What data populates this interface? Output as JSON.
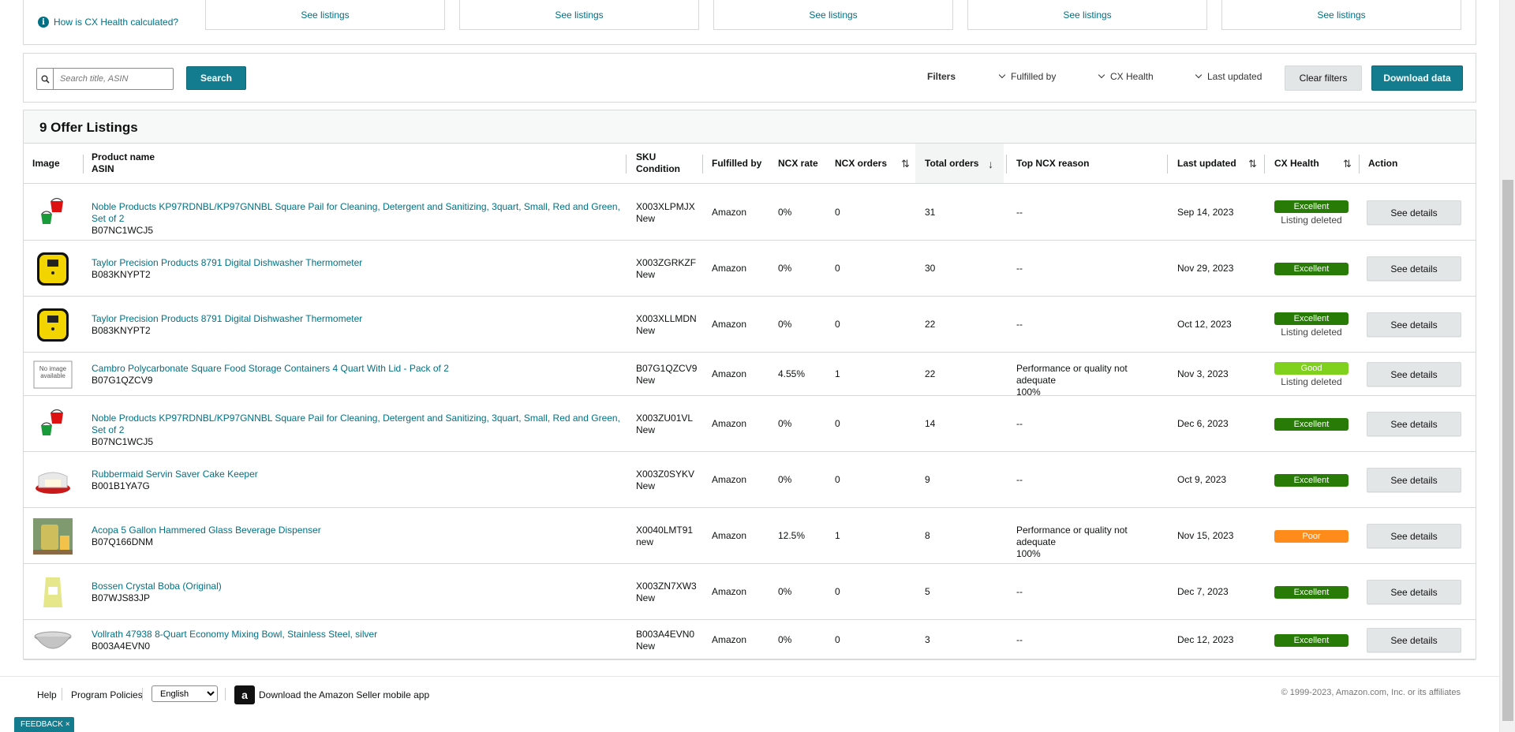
{
  "stats": {
    "how_calculated": "How is CX Health calculated?",
    "cells": [
      "See listings",
      "See listings",
      "See listings",
      "See listings",
      "See listings"
    ]
  },
  "toolbar": {
    "search_placeholder": "Search title, ASIN",
    "search_label": "Search",
    "filters_label": "Filters",
    "filter_fulfilled_by": "Fulfilled by",
    "filter_cx_health": "CX Health",
    "filter_last_updated": "Last updated",
    "clear_filters": "Clear filters",
    "download_data": "Download data"
  },
  "table": {
    "title": "9 Offer Listings",
    "headers": {
      "image": "Image",
      "product_name": "Product name",
      "asin": "ASIN",
      "sku": "SKU",
      "condition": "Condition",
      "fulfilled_by": "Fulfilled by",
      "ncx_rate": "NCX rate",
      "ncx_orders": "NCX orders",
      "total_orders": "Total orders",
      "top_ncx_reason": "Top NCX reason",
      "last_updated": "Last updated",
      "cx_health": "CX Health",
      "action": "Action"
    },
    "rows": [
      {
        "image": "red-green-pails",
        "name": "Noble Products KP97RDNBL/KP97GNNBL Square Pail for Cleaning, Detergent and Sanitizing, 3quart, Small, Red and Green, Set of 2",
        "asin": "B07NC1WCJ5",
        "sku": "X003XLPMJX",
        "condition": "New",
        "fulfilled_by": "Amazon",
        "ncx_rate": "0%",
        "ncx_orders": "0",
        "total_orders": "31",
        "reason_1": "--",
        "reason_2": "",
        "last_updated": "Sep 14, 2023",
        "health": "Excellent",
        "health_class": "excellent",
        "status": "Listing deleted",
        "action": "See details"
      },
      {
        "image": "yellow-thermometer",
        "name": "Taylor Precision Products 8791 Digital Dishwasher Thermometer",
        "asin": "B083KNYPT2",
        "sku": "X003ZGRKZF",
        "condition": "New",
        "fulfilled_by": "Amazon",
        "ncx_rate": "0%",
        "ncx_orders": "0",
        "total_orders": "30",
        "reason_1": "--",
        "reason_2": "",
        "last_updated": "Nov 29, 2023",
        "health": "Excellent",
        "health_class": "excellent",
        "status": "",
        "action": "See details"
      },
      {
        "image": "yellow-thermometer",
        "name": "Taylor Precision Products 8791 Digital Dishwasher Thermometer",
        "asin": "B083KNYPT2",
        "sku": "X003XLLMDN",
        "condition": "New",
        "fulfilled_by": "Amazon",
        "ncx_rate": "0%",
        "ncx_orders": "0",
        "total_orders": "22",
        "reason_1": "--",
        "reason_2": "",
        "last_updated": "Oct 12, 2023",
        "health": "Excellent",
        "health_class": "excellent",
        "status": "Listing deleted",
        "action": "See details"
      },
      {
        "image": "no-image",
        "no_image_text": "No image available",
        "name": "Cambro Polycarbonate Square Food Storage Containers 4 Quart With Lid - Pack of 2",
        "asin": "B07G1QZCV9",
        "sku": "B07G1QZCV9",
        "condition": "New",
        "fulfilled_by": "Amazon",
        "ncx_rate": "4.55%",
        "ncx_orders": "1",
        "total_orders": "22",
        "reason_1": "Performance or quality not adequate",
        "reason_2": "100%",
        "last_updated": "Nov 3, 2023",
        "health": "Good",
        "health_class": "good",
        "status": "Listing deleted",
        "action": "See details"
      },
      {
        "image": "red-green-pails",
        "name": "Noble Products KP97RDNBL/KP97GNNBL Square Pail for Cleaning, Detergent and Sanitizing, 3quart, Small, Red and Green, Set of 2",
        "asin": "B07NC1WCJ5",
        "sku": "X003ZU01VL",
        "condition": "New",
        "fulfilled_by": "Amazon",
        "ncx_rate": "0%",
        "ncx_orders": "0",
        "total_orders": "14",
        "reason_1": "--",
        "reason_2": "",
        "last_updated": "Dec 6, 2023",
        "health": "Excellent",
        "health_class": "excellent",
        "status": "",
        "action": "See details"
      },
      {
        "image": "cake-keeper",
        "name": "Rubbermaid Servin Saver Cake Keeper",
        "asin": "B001B1YA7G",
        "sku": "X003Z0SYKV",
        "condition": "New",
        "fulfilled_by": "Amazon",
        "ncx_rate": "0%",
        "ncx_orders": "0",
        "total_orders": "9",
        "reason_1": "--",
        "reason_2": "",
        "last_updated": "Oct 9, 2023",
        "health": "Excellent",
        "health_class": "excellent",
        "status": "",
        "action": "See details"
      },
      {
        "image": "beverage-dispenser",
        "name": "Acopa 5 Gallon Hammered Glass Beverage Dispenser",
        "asin": "B07Q166DNM",
        "sku": "X0040LMT91",
        "condition": "new",
        "fulfilled_by": "Amazon",
        "ncx_rate": "12.5%",
        "ncx_orders": "1",
        "total_orders": "8",
        "reason_1": "Performance or quality not adequate",
        "reason_2": "100%",
        "last_updated": "Nov 15, 2023",
        "health": "Poor",
        "health_class": "poor",
        "status": "",
        "action": "See details"
      },
      {
        "image": "boba-bag",
        "name": "Bossen Crystal Boba (Original)",
        "asin": "B07WJS83JP",
        "sku": "X003ZN7XW3",
        "condition": "New",
        "fulfilled_by": "Amazon",
        "ncx_rate": "0%",
        "ncx_orders": "0",
        "total_orders": "5",
        "reason_1": "--",
        "reason_2": "",
        "last_updated": "Dec 7, 2023",
        "health": "Excellent",
        "health_class": "excellent",
        "status": "",
        "action": "See details"
      },
      {
        "image": "mixing-bowl",
        "name": "Vollrath 47938 8-Quart Economy Mixing Bowl, Stainless Steel, silver",
        "asin": "B003A4EVN0",
        "sku": "B003A4EVN0",
        "condition": "New",
        "fulfilled_by": "Amazon",
        "ncx_rate": "0%",
        "ncx_orders": "0",
        "total_orders": "3",
        "reason_1": "--",
        "reason_2": "",
        "last_updated": "Dec 12, 2023",
        "health": "Excellent",
        "health_class": "excellent",
        "status": "",
        "action": "See details"
      }
    ]
  },
  "footer": {
    "help": "Help",
    "program_policies": "Program Policies",
    "language": "English",
    "app_icon_letter": "a",
    "app_text": "Download the Amazon Seller mobile app",
    "copyright": "© 1999-2023, Amazon.com, Inc. or its affiliates"
  },
  "feedback": {
    "label": "FEEDBACK",
    "close": "×"
  },
  "colors": {
    "accent": "#147c8f",
    "link": "#007185",
    "excellent": "#277b06",
    "good": "#7fd11e",
    "poor": "#ff8c1a"
  }
}
